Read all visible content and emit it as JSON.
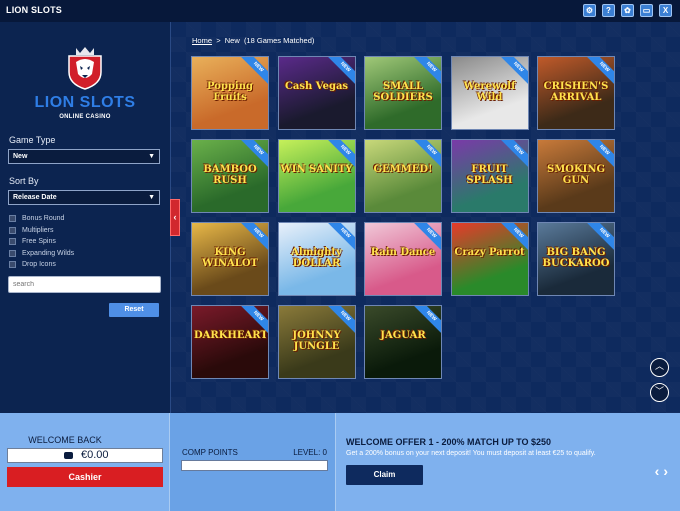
{
  "app": {
    "title": "LION SLOTS"
  },
  "top_icons": [
    {
      "name": "gear-icon",
      "glyph": "⚙"
    },
    {
      "name": "help-icon",
      "glyph": "?"
    },
    {
      "name": "settings-icon",
      "glyph": "✿"
    },
    {
      "name": "chat-icon",
      "glyph": "▭"
    },
    {
      "name": "close-icon",
      "glyph": "X"
    }
  ],
  "logo": {
    "title": "LION SLOTS",
    "subtitle": "ONLINE CASINO"
  },
  "filters": {
    "game_type_label": "Game Type",
    "game_type_value": "New",
    "sort_by_label": "Sort By",
    "sort_by_value": "Release Date",
    "features": [
      "Bonus Round",
      "Multipliers",
      "Free Spins",
      "Expanding Wilds",
      "Drop Icons"
    ],
    "search_placeholder": "search",
    "reset_label": "Reset"
  },
  "breadcrumb": {
    "home": "Home",
    "separator": ">",
    "current": "New",
    "count": "(18 Games Matched)"
  },
  "games": [
    {
      "title": "Popping Fruits",
      "badge": "NEW",
      "bg": "#c96a2a",
      "bg2": "#e9b05a"
    },
    {
      "title": "Cash Vegas",
      "badge": "NEW",
      "bg": "#1a1a2e",
      "bg2": "#5a2a8a"
    },
    {
      "title": "SMALL SOLDIERS",
      "badge": "NEW",
      "bg": "#2f6b2a",
      "bg2": "#a0c878"
    },
    {
      "title": "Werewolf Wild",
      "badge": "NEW",
      "bg": "#e8e8e8",
      "bg2": "#8a8a8a"
    },
    {
      "title": "CRISHEN'S ARRIVAL",
      "badge": "NEW",
      "bg": "#3d2a18",
      "bg2": "#c05a2a"
    },
    {
      "title": "BAMBOO RUSH",
      "badge": "NEW",
      "bg": "#2a6a2a",
      "bg2": "#6ab04a"
    },
    {
      "title": "WIN SANITY",
      "badge": "NEW",
      "bg": "#48a83a",
      "bg2": "#c6f05a"
    },
    {
      "title": "GEMMED!",
      "badge": "NEW",
      "bg": "#5a8a3a",
      "bg2": "#c8d87a"
    },
    {
      "title": "FRUIT SPLASH",
      "badge": "NEW",
      "bg": "#2a7a6a",
      "bg2": "#7a3aa8"
    },
    {
      "title": "SMOKING GUN",
      "badge": "NEW",
      "bg": "#5a3a1a",
      "bg2": "#c87a3a"
    },
    {
      "title": "KING WINALOT",
      "badge": "NEW",
      "bg": "#6a4a1a",
      "bg2": "#e8b848"
    },
    {
      "title": "Almighty DOLLAR",
      "badge": "NEW",
      "bg": "#7ab8e8",
      "bg2": "#e8f0fa"
    },
    {
      "title": "Rain Dance",
      "badge": "NEW",
      "bg": "#d85a8a",
      "bg2": "#f0c8d8"
    },
    {
      "title": "Crazy Parrot",
      "badge": "NEW",
      "bg": "#2a8a2a",
      "bg2": "#e83a2a"
    },
    {
      "title": "BIG BANG BUCKAROO",
      "badge": "NEW",
      "bg": "#1a2a3a",
      "bg2": "#5a7a9a"
    },
    {
      "title": "DARKHEARTS",
      "badge": "NEW",
      "bg": "#2a0a0a",
      "bg2": "#7a1a2a"
    },
    {
      "title": "JOHNNY JUNGLE",
      "badge": "NEW",
      "bg": "#3a3a1a",
      "bg2": "#8a7a3a"
    },
    {
      "title": "JAGUAR",
      "badge": "NEW",
      "bg": "#0a1a0a",
      "bg2": "#3a4a2a"
    }
  ],
  "footer": {
    "welcome_back": "WELCOME BACK",
    "balance": "€0.00",
    "cashier_label": "Cashier",
    "comp_points_label": "COMP POINTS",
    "level_label": "LEVEL: 0",
    "comp_progress": 0.0,
    "offer_title": "WELCOME OFFER 1 - 200% MATCH UP TO $250",
    "offer_text": "Get a 200% bonus on your next deposit! You must deposit at least €25 to qualify.",
    "claim_label": "Claim",
    "prev_glyph": "‹",
    "next_glyph": "›"
  },
  "scroll": {
    "up_glyph": "︿",
    "down_glyph": "﹀"
  },
  "colors": {
    "accent": "#2f7ee6",
    "danger": "#d91e22",
    "footer": "#7fb1ee",
    "bg": "#0b1f44"
  }
}
